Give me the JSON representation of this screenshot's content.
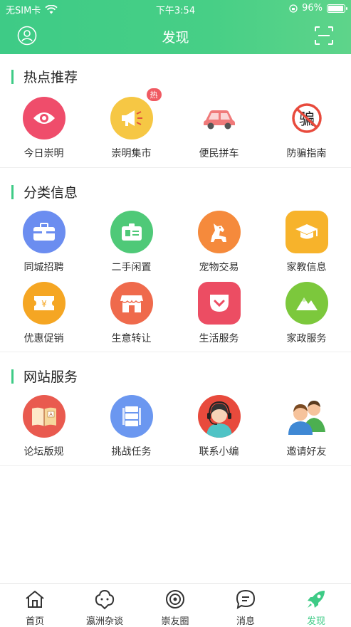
{
  "status_bar": {
    "carrier": "无SIM卡",
    "time": "下午3:54",
    "battery": "96%",
    "battery_level": 0.96
  },
  "header": {
    "title": "发现"
  },
  "sections": [
    {
      "title": "热点推荐",
      "items": [
        {
          "label": "今日崇明",
          "icon": "eye-icon",
          "color": "#ef4d6b"
        },
        {
          "label": "崇明集市",
          "icon": "megaphone-icon",
          "color": "#f6c744",
          "badge": "热"
        },
        {
          "label": "便民拼车",
          "icon": "car-icon",
          "color": "#f07a7a"
        },
        {
          "label": "防骗指南",
          "icon": "no-fraud-icon",
          "color": "#e84a3c"
        }
      ]
    },
    {
      "title": "分类信息",
      "items": [
        {
          "label": "同城招聘",
          "icon": "briefcase-icon",
          "color": "#6b8df0"
        },
        {
          "label": "二手闲置",
          "icon": "id-card-icon",
          "color": "#4fc978"
        },
        {
          "label": "宠物交易",
          "icon": "dog-icon",
          "color": "#f58a3c"
        },
        {
          "label": "家教信息",
          "icon": "graduation-cap-icon",
          "color": "#f7b32b"
        },
        {
          "label": "优惠促销",
          "icon": "coupon-icon",
          "color": "#f5a623"
        },
        {
          "label": "生意转让",
          "icon": "shop-icon",
          "color": "#ef6a4c"
        },
        {
          "label": "生活服务",
          "icon": "pocket-icon",
          "color": "#ec4d63"
        },
        {
          "label": "家政服务",
          "icon": "mountain-icon",
          "color": "#7cc83c"
        }
      ]
    },
    {
      "title": "网站服务",
      "items": [
        {
          "label": "论坛版规",
          "icon": "book-icon",
          "color": "#e95a4f"
        },
        {
          "label": "挑战任务",
          "icon": "task-icon",
          "color": "#6b97f0"
        },
        {
          "label": "联系小编",
          "icon": "support-agent-icon",
          "color": "#e84a3c"
        },
        {
          "label": "邀请好友",
          "icon": "friends-icon",
          "color": "#f29a5c"
        }
      ]
    }
  ],
  "tabbar": [
    {
      "label": "首页",
      "icon": "home-icon"
    },
    {
      "label": "瀛洲杂谈",
      "icon": "chat-bubble-icon"
    },
    {
      "label": "崇友圈",
      "icon": "circle-icon"
    },
    {
      "label": "消息",
      "icon": "message-icon"
    },
    {
      "label": "发现",
      "icon": "rocket-icon",
      "active": true
    }
  ]
}
